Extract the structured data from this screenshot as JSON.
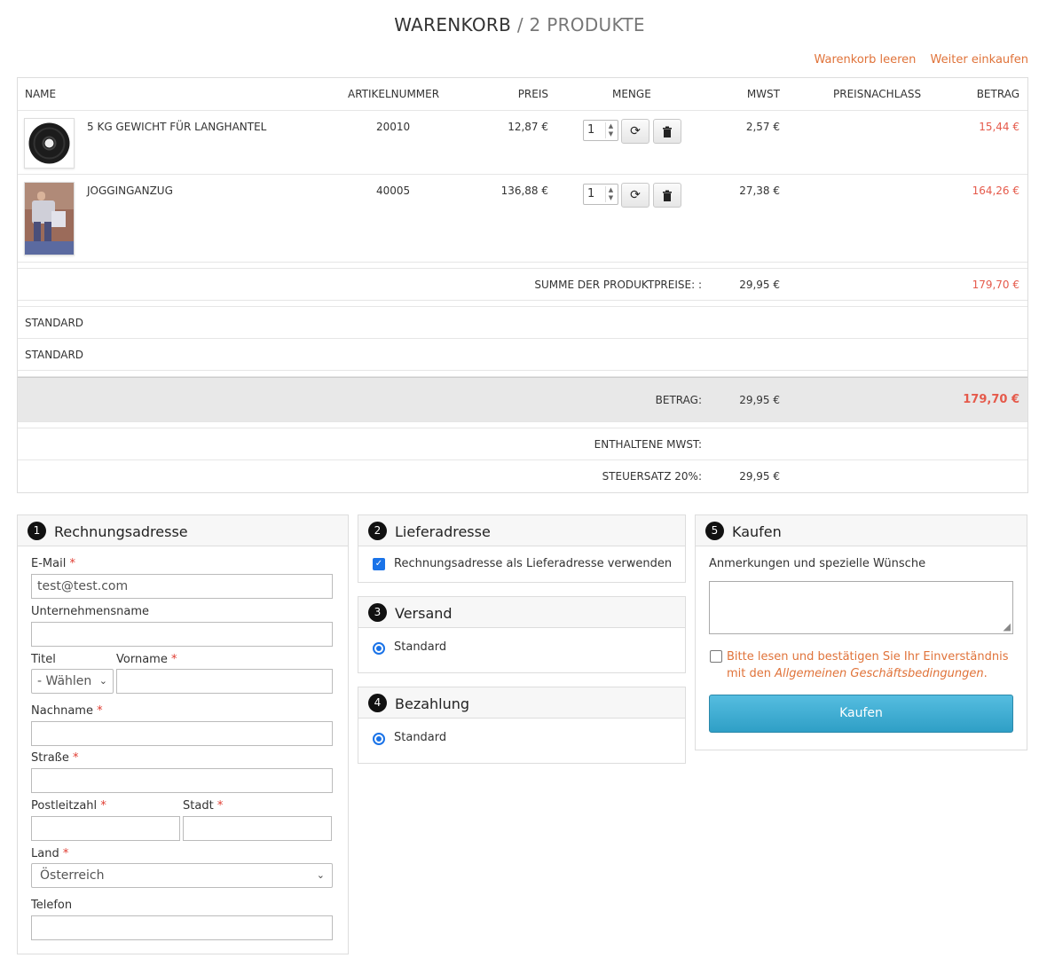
{
  "title": {
    "main": "WARENKORB",
    "sep": "/",
    "count": "2 PRODUKTE"
  },
  "links": {
    "clear": "Warenkorb leeren",
    "continue": "Weiter einkaufen"
  },
  "columns": {
    "name": "NAME",
    "sku": "ARTIKELNUMMER",
    "price": "PREIS",
    "qty": "MENGE",
    "vat": "MWST",
    "discount": "PREISNACHLASS",
    "amount": "BETRAG"
  },
  "products": [
    {
      "name": "5 KG GEWICHT FÜR LANGHANTEL",
      "sku": "20010",
      "price": "12,87 €",
      "qty": "1",
      "vat": "2,57 €",
      "amount": "15,44 €"
    },
    {
      "name": "JOGGINGANZUG",
      "sku": "40005",
      "price": "136,88 €",
      "qty": "1",
      "vat": "27,38 €",
      "amount": "164,26 €"
    }
  ],
  "summary": {
    "subtotal_label": "SUMME DER PRODUKTPREISE: :",
    "subtotal_vat": "29,95 €",
    "subtotal_amount": "179,70 €",
    "shipping_label": "STANDARD",
    "payment_label": "STANDARD",
    "total_label": "BETRAG:",
    "total_vat": "29,95 €",
    "total_amount": "179,70 €",
    "incl_vat_label": "ENTHALTENE MWST:",
    "tax_rate_label": "STEUERSATZ 20%:",
    "tax_rate_value": "29,95 €"
  },
  "icons": {
    "refresh": "refresh-icon",
    "trash": "trash-icon",
    "check": "check-icon",
    "chevron": "chevron-down-icon"
  },
  "billing": {
    "num": "1",
    "title": "Rechnungsadresse",
    "email_label": "E-Mail",
    "email_value": "test@test.com",
    "company_label": "Unternehmensname",
    "salutation_label": "Titel",
    "salutation_value": "- Wählen",
    "firstname_label": "Vorname",
    "lastname_label": "Nachname",
    "street_label": "Straße",
    "zip_label": "Postleitzahl",
    "city_label": "Stadt",
    "country_label": "Land",
    "country_value": "Österreich",
    "phone_label": "Telefon",
    "required_mark": "*"
  },
  "shipping_addr": {
    "num": "2",
    "title": "Lieferadresse",
    "same_label": "Rechnungsadresse als Lieferadresse verwenden"
  },
  "delivery": {
    "num": "3",
    "title": "Versand",
    "option": "Standard"
  },
  "payment": {
    "num": "4",
    "title": "Bezahlung",
    "option": "Standard"
  },
  "buy": {
    "num": "5",
    "title": "Kaufen",
    "notes_label": "Anmerkungen und spezielle Wünsche",
    "terms_text_1": "Bitte lesen und bestätigen Sie Ihr Einverständnis",
    "terms_text_2": "mit den",
    "terms_link": "Allgemeinen Geschäftsbedingungen",
    "terms_end": ".",
    "button": "Kaufen"
  },
  "colors": {
    "accent": "#e0733a",
    "price_red": "#e55a4b",
    "button": "#3aa9d1",
    "checkbox": "#1a73e8"
  }
}
